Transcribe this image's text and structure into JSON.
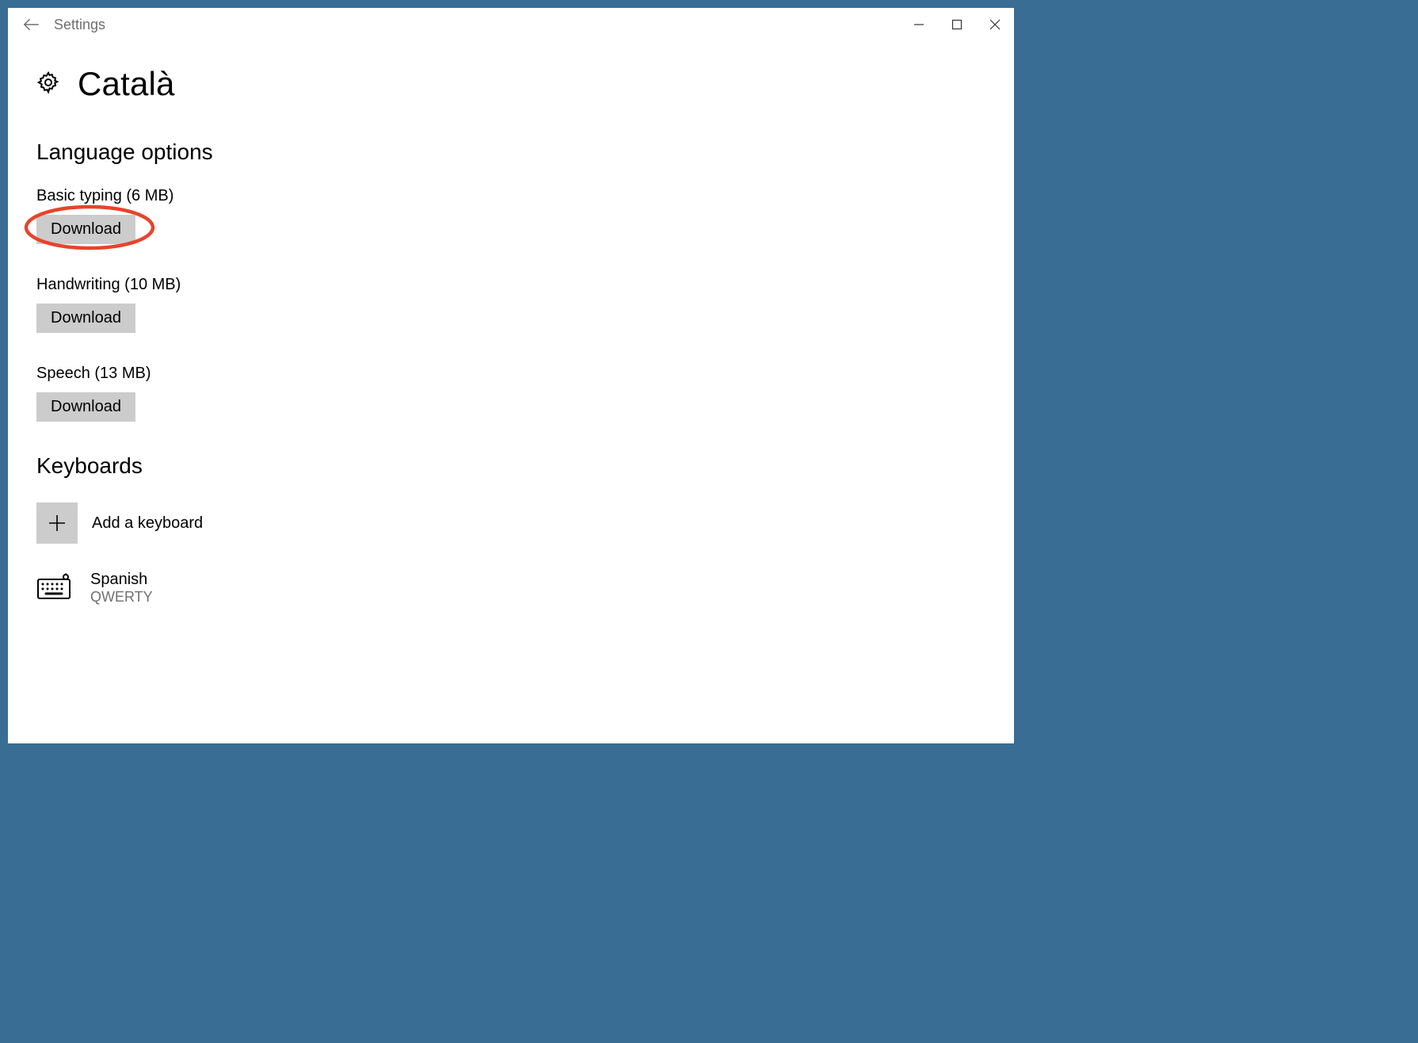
{
  "window": {
    "title": "Settings"
  },
  "page": {
    "title": "Català"
  },
  "sections": {
    "languageOptions": {
      "heading": "Language options",
      "items": [
        {
          "label": "Basic typing (6 MB)",
          "button": "Download",
          "highlighted": true
        },
        {
          "label": "Handwriting (10 MB)",
          "button": "Download",
          "highlighted": false
        },
        {
          "label": "Speech (13 MB)",
          "button": "Download",
          "highlighted": false
        }
      ]
    },
    "keyboards": {
      "heading": "Keyboards",
      "addLabel": "Add a keyboard",
      "items": [
        {
          "name": "Spanish",
          "layout": "QWERTY"
        }
      ]
    }
  }
}
